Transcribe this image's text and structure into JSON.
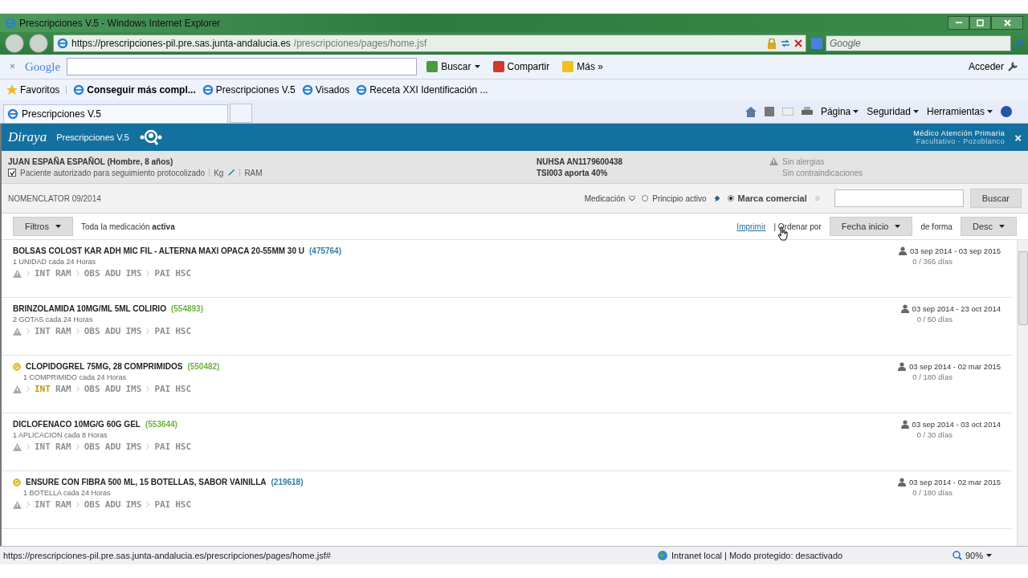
{
  "window": {
    "title": "Prescripciones V.5 - Windows Internet Explorer"
  },
  "address_bar": {
    "url_host": "https://prescripciones-pil.pre.sas.junta-andalucia.es",
    "url_path": "/prescripciones/pages/home.jsf",
    "search_placeholder": "Google"
  },
  "google_toolbar": {
    "close": "×",
    "logo": "Google",
    "buttons": [
      "Buscar",
      "Compartir",
      "Más »"
    ],
    "signin": "Acceder"
  },
  "favorites_bar": {
    "label": "Favoritos",
    "items": [
      {
        "label": "Conseguir más compl...",
        "bold": true
      },
      {
        "label": "Prescripciones V.5",
        "bold": false
      },
      {
        "label": "Visados",
        "bold": false
      },
      {
        "label": "Receta XXI Identificación ...",
        "bold": false
      }
    ]
  },
  "tabs": [
    {
      "label": "Prescripciones V.5",
      "selected": true
    }
  ],
  "command_bar": [
    "Página",
    "Seguridad",
    "Herramientas"
  ],
  "app_header": {
    "logo": "Diraya",
    "title": "Prescripciones V.5",
    "user_role": "Médico Atención Primaria",
    "user_place": "Facultativo - Pozoblanco",
    "close": "×"
  },
  "patient": {
    "name": "JUAN ESPAÑA ESPAÑOL (Hombre, 8 años)",
    "authorized": {
      "label": "Paciente autorizado para seguimiento protocolizado",
      "checked": true
    },
    "weight": "Kg",
    "ram": "RAM",
    "nuhsa": "NUHSA AN1179600438",
    "tsi": "TSI003 aporta 40%",
    "allergies": "Sin alergias",
    "contraindications": "Sin contraindicaciones"
  },
  "search": {
    "nomenclator": "NOMENCLATOR 09/2014",
    "medication": "Medicación",
    "options": [
      {
        "label": "Principio activo",
        "selected": false
      },
      {
        "label": "Marca comercial",
        "selected": true
      }
    ],
    "button": "Buscar"
  },
  "filter_bar": {
    "filter_button": "Filtros",
    "scope": "Toda la medicación **activa**",
    "print_link": "Imprimir",
    "sort_label": "| Ordenar por",
    "sort_field": "Fecha inicio",
    "order_label": "de forma",
    "order": "Desc"
  },
  "medications": [
    {
      "name": "BOLSAS COLOST KAR ADH MIC FIL - ALTERNA MAXI OPACA 20-55MM 30 U",
      "code": "(475764)",
      "color": "#2f7fa8",
      "dose": "1 UNIDAD cada 24 Horas",
      "flagged": false,
      "tags": [
        [
          {
            "label": "INT",
            "active": false
          },
          {
            "label": "RAM",
            "active": false
          }
        ],
        [
          {
            "label": "OBS",
            "active": false
          },
          {
            "label": "ADU",
            "active": false
          },
          {
            "label": "IMS",
            "active": false
          }
        ],
        [
          {
            "label": "PAI",
            "active": false
          },
          {
            "label": "HSC",
            "active": false
          }
        ]
      ],
      "dates": "03 sep 2014 - 03 sep 2015",
      "days": "0 / 365 días"
    },
    {
      "name": "BRINZOLAMIDA 10MG/ML 5ML COLIRIO",
      "code": "(554893)",
      "color": "#6db33f",
      "dose": "2 GOTAS cada 24 Horas",
      "flagged": false,
      "tags": [
        [
          {
            "label": "INT",
            "active": false
          },
          {
            "label": "RAM",
            "active": false
          }
        ],
        [
          {
            "label": "OBS",
            "active": false
          },
          {
            "label": "ADU",
            "active": false
          },
          {
            "label": "IMS",
            "active": false
          }
        ],
        [
          {
            "label": "PAI",
            "active": false
          },
          {
            "label": "HSC",
            "active": false
          }
        ]
      ],
      "dates": "03 sep 2014 - 23 oct 2014",
      "days": "0 / 50 días"
    },
    {
      "name": "CLOPIDOGREL 75MG, 28 COMPRIMIDOS",
      "code": "(550482)",
      "color": "#6db33f",
      "dose": "1 COMPRIMIDO cada 24 Horas",
      "flagged": true,
      "tags": [
        [
          {
            "label": "INT",
            "active": true
          },
          {
            "label": "RAM",
            "active": false
          }
        ],
        [
          {
            "label": "OBS",
            "active": false
          },
          {
            "label": "ADU",
            "active": false
          },
          {
            "label": "IMS",
            "active": false
          }
        ],
        [
          {
            "label": "PAI",
            "active": false
          },
          {
            "label": "HSC",
            "active": false
          }
        ]
      ],
      "dates": "03 sep 2014 - 02 mar 2015",
      "days": "0 / 180 días"
    },
    {
      "name": "DICLOFENACO 10MG/G 60G GEL",
      "code": "(553644)",
      "color": "#6db33f",
      "dose": "1 APLICACION cada 8 Horas",
      "flagged": false,
      "tags": [
        [
          {
            "label": "INT",
            "active": false
          },
          {
            "label": "RAM",
            "active": false
          }
        ],
        [
          {
            "label": "OBS",
            "active": false
          },
          {
            "label": "ADU",
            "active": false
          },
          {
            "label": "IMS",
            "active": false
          }
        ],
        [
          {
            "label": "PAI",
            "active": false
          },
          {
            "label": "HSC",
            "active": false
          }
        ]
      ],
      "dates": "03 sep 2014 - 03 oct 2014",
      "days": "0 / 30 días"
    },
    {
      "name": "ENSURE CON FIBRA 500 ML, 15 BOTELLAS, SABOR VAINILLA",
      "code": "(219618)",
      "color": "#2f7fa8",
      "dose": "1 BOTELLA cada 24 Horas",
      "flagged": true,
      "tags": [
        [
          {
            "label": "INT",
            "active": false
          },
          {
            "label": "RAM",
            "active": false
          }
        ],
        [
          {
            "label": "OBS",
            "active": false
          },
          {
            "label": "ADU",
            "active": false
          },
          {
            "label": "IMS",
            "active": false
          }
        ],
        [
          {
            "label": "PAI",
            "active": false
          },
          {
            "label": "HSC",
            "active": false
          }
        ]
      ],
      "dates": "03 sep 2014 - 02 mar 2015",
      "days": "0 / 180 días"
    }
  ],
  "status_bar": {
    "url": "https://prescripciones-pil.pre.sas.junta-andalucia.es/prescripciones/pages/home.jsf#",
    "zone": "Intranet local | Modo protegido: desactivado",
    "zoom": "90%"
  }
}
